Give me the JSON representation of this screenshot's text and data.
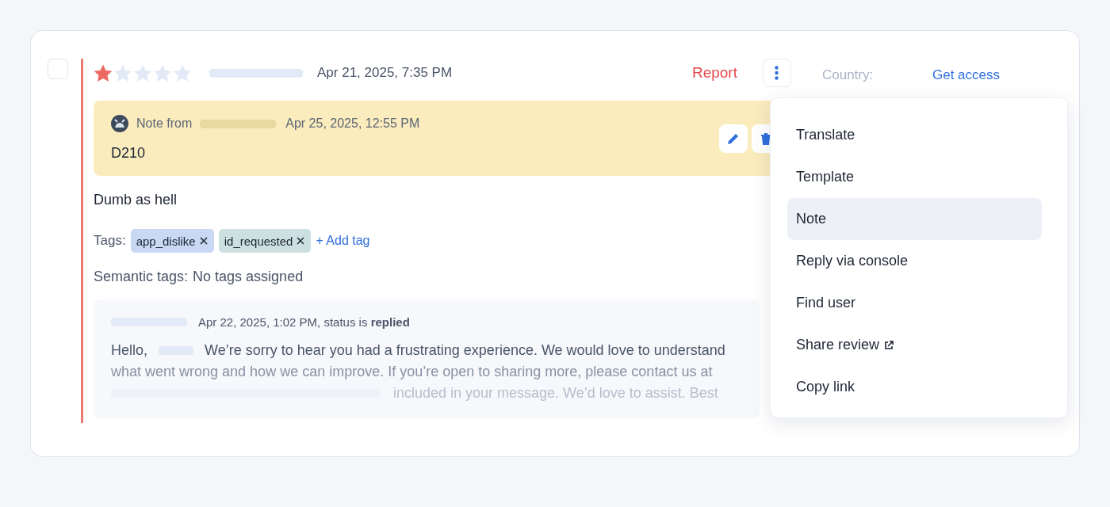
{
  "review": {
    "checked": false,
    "stars": 1,
    "date": "Apr 21, 2025, 7:35 PM",
    "report": "Report",
    "country_label": "Country:",
    "get_access": "Get access"
  },
  "note": {
    "prefix": "Note from",
    "date": "Apr 25, 2025, 12:55 PM",
    "text": "D210"
  },
  "body": "Dumb as hell",
  "tags": {
    "label": "Tags:",
    "items": [
      {
        "label": "app_dislike",
        "color": "#c9d9f4"
      },
      {
        "label": "id_requested",
        "color": "#cde0e1"
      }
    ],
    "add": "+ Add tag"
  },
  "semantic_tags": {
    "label": "Semantic tags:",
    "value": "No tags assigned"
  },
  "reply": {
    "status_line": "Apr 22, 2025, 1:02 PM, status is **replied**",
    "greeting": "Hello,",
    "lines": [
      "We’re sorry to hear you had a frustrating experience. We would love to understand",
      "what went wrong and how we can improve. If you’re open to sharing more, please contact us at",
      "included in your message. We’d love to assist. Best"
    ]
  },
  "menu": {
    "items": [
      {
        "label": "Translate",
        "selected": false,
        "external": false
      },
      {
        "label": "Template",
        "selected": false,
        "external": false
      },
      {
        "label": "Note",
        "selected": true,
        "external": false
      },
      {
        "label": "Reply via console",
        "selected": false,
        "external": false
      },
      {
        "label": "Find user",
        "selected": false,
        "external": false
      },
      {
        "label": "Share review",
        "selected": false,
        "external": true
      },
      {
        "label": "Copy link",
        "selected": false,
        "external": false
      }
    ]
  }
}
